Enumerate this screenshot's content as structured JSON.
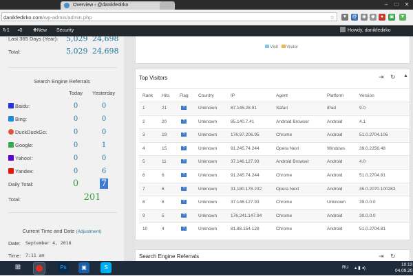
{
  "browser": {
    "tabs": [
      {
        "label": "Overview ‹ @danikfedirko",
        "active": true
      },
      {
        "label": "",
        "active": false
      }
    ],
    "url_host": "danikfedirko.com",
    "url_path": "/wp-admin/admin.php"
  },
  "admin_bar": {
    "comments_count": "0",
    "pending_count": "1",
    "new_label": "New",
    "security_label": "Security",
    "greeting": "Howdy, danikfedirko"
  },
  "summary": {
    "rows": [
      {
        "label": "Last 365 Days (Year):",
        "visitors": "5,029",
        "visits": "24,698"
      },
      {
        "label": "Total:",
        "visitors": "5,029",
        "visits": "24,698"
      }
    ]
  },
  "search_referrals": {
    "title": "Search Engine Referrals",
    "col_today": "Today",
    "col_yesterday": "Yesterday",
    "engines": [
      {
        "name": "Baidu:",
        "today": "0",
        "yesterday": "0",
        "color": "#2932e1"
      },
      {
        "name": "Bing:",
        "today": "0",
        "yesterday": "0",
        "color": "#1a8cd8"
      },
      {
        "name": "DuckDuckGo:",
        "today": "0",
        "yesterday": "0",
        "color": "#de5833"
      },
      {
        "name": "Google:",
        "today": "0",
        "yesterday": "1",
        "color": "#34a853"
      },
      {
        "name": "Yahoo!:",
        "today": "0",
        "yesterday": "0",
        "color": "#6001d2"
      },
      {
        "name": "Yandex:",
        "today": "0",
        "yesterday": "6",
        "color": "#e61400"
      }
    ],
    "daily_total_label": "Daily Total:",
    "daily_total_today": "0",
    "daily_total_yesterday": "7",
    "total_label": "Total:",
    "total_value": "201"
  },
  "time_panel": {
    "title": "Current Time and Date",
    "adjust_link": "(Adjustment)",
    "date_label": "Date:",
    "date_value": "September 4, 2016",
    "time_label": "Time:",
    "time_value": "7:11 am"
  },
  "chart_legend": {
    "visit": "Visit",
    "visitor": "Visitor",
    "visit_color": "#7cc7e4",
    "visitor_color": "#f0b24e"
  },
  "top_visitors": {
    "title": "Top Visitors",
    "columns": [
      "Rank",
      "Hits",
      "Flag",
      "Country",
      "IP",
      "Agent",
      "Platform",
      "Version"
    ],
    "rows": [
      [
        "1",
        "21",
        "?",
        "Unknown",
        "87.145.28.91",
        "Safari",
        "iPad",
        "9.0"
      ],
      [
        "2",
        "20",
        "?",
        "Unknown",
        "85.140.7.41",
        "Android Browser",
        "Android",
        "4.1"
      ],
      [
        "3",
        "19",
        "?",
        "Unknown",
        "176.97.206.95",
        "Chrome",
        "Android",
        "51.0.2704.106"
      ],
      [
        "4",
        "15",
        "?",
        "Unknown",
        "91.245.74.244",
        "Opera Next",
        "Windows",
        "39.0.2256.48"
      ],
      [
        "5",
        "11",
        "?",
        "Unknown",
        "37.146.127.93",
        "Android Browser",
        "Android",
        "4.0"
      ],
      [
        "6",
        "6",
        "?",
        "Unknown",
        "91.245.74.244",
        "Chrome",
        "Android",
        "51.0.2704.81"
      ],
      [
        "7",
        "6",
        "?",
        "Unknown",
        "31.180.178.232",
        "Opera Next",
        "Android",
        "35.0.2070.100283"
      ],
      [
        "8",
        "6",
        "?",
        "Unknown",
        "37.146.127.93",
        "Chrome",
        "Unknown",
        "39.0.0.0"
      ],
      [
        "9",
        "5",
        "?",
        "Unknown",
        "176.241.147.94",
        "Chrome",
        "Android",
        "30.0.0.0"
      ],
      [
        "10",
        "4",
        "?",
        "Unknown",
        "81.88.154.128",
        "Chrome",
        "Android",
        "51.0.2704.81"
      ]
    ]
  },
  "bottom_panel": {
    "title": "Search Engine Referrals"
  },
  "taskbar": {
    "language": "RU",
    "clock_time": "10:13",
    "clock_date": "04.09.20"
  }
}
